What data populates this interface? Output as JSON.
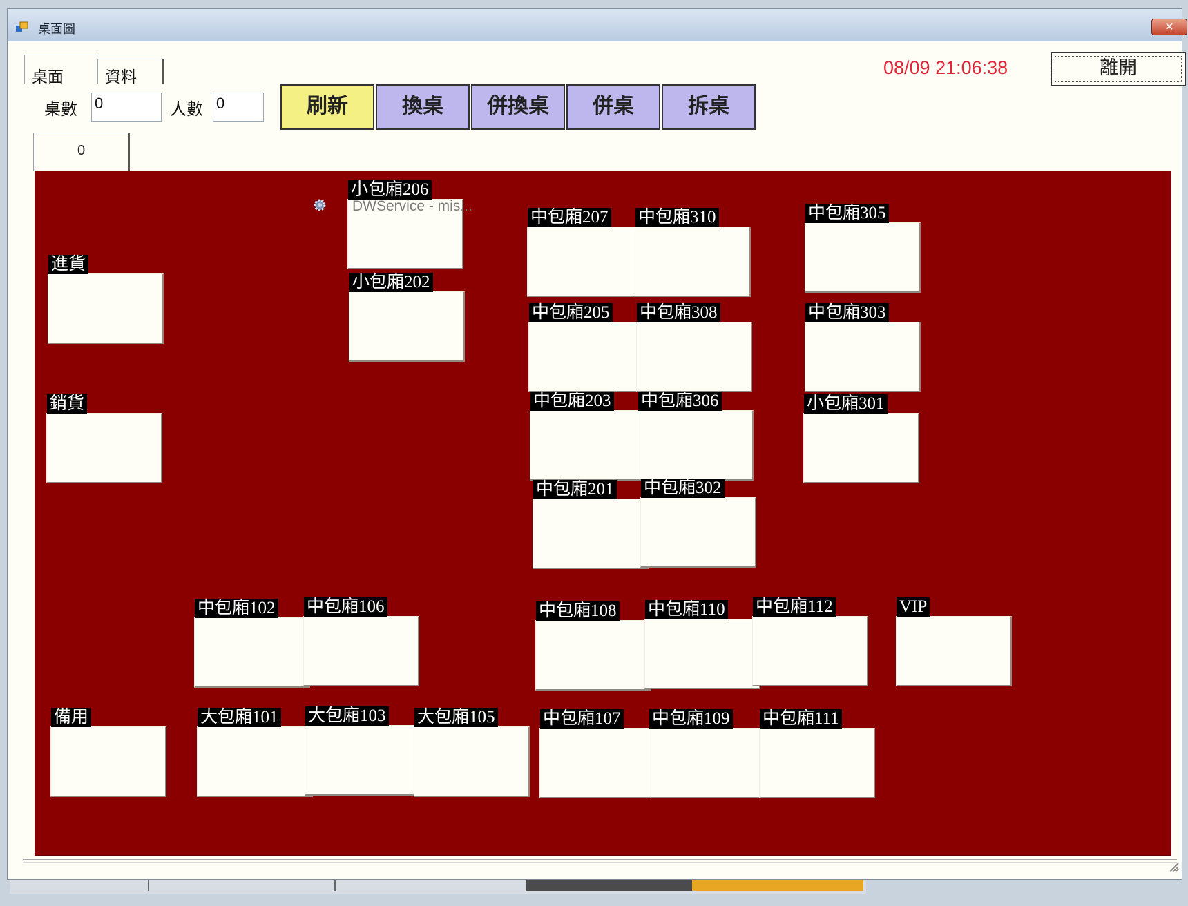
{
  "window": {
    "title": "桌面圖",
    "close_symbol": "✕"
  },
  "tabs": [
    "桌面",
    "資料"
  ],
  "clock": "08/09 21:06:38",
  "exit_button": "離開",
  "toolbar": {
    "table_count_label": "桌數",
    "table_count_value": "0",
    "people_count_label": "人數",
    "people_count_value": "0",
    "buttons": [
      "刷新",
      "換桌",
      "併換桌",
      "併桌",
      "拆桌"
    ]
  },
  "zone_tab": "0",
  "colors": {
    "floor": "#8a0000",
    "refresh": "#f4f083",
    "action": "#bdb7ee",
    "clock": "#e0283a"
  },
  "tables": [
    {
      "name": "小包廂206",
      "note": "DWService - mis..."
    },
    {
      "name": "中包廂207"
    },
    {
      "name": "中包廂310"
    },
    {
      "name": "中包廂305"
    },
    {
      "name": "進貨"
    },
    {
      "name": "小包廂202"
    },
    {
      "name": "中包廂205"
    },
    {
      "name": "中包廂308"
    },
    {
      "name": "中包廂303"
    },
    {
      "name": "銷貨"
    },
    {
      "name": "中包廂203"
    },
    {
      "name": "中包廂306"
    },
    {
      "name": "小包廂301"
    },
    {
      "name": "中包廂201"
    },
    {
      "name": "中包廂302"
    },
    {
      "name": "中包廂102"
    },
    {
      "name": "中包廂106"
    },
    {
      "name": "中包廂108"
    },
    {
      "name": "中包廂110"
    },
    {
      "name": "中包廂112"
    },
    {
      "name": "VIP"
    },
    {
      "name": "備用"
    },
    {
      "name": "大包廂101"
    },
    {
      "name": "大包廂103"
    },
    {
      "name": "大包廂105"
    },
    {
      "name": "中包廂107"
    },
    {
      "name": "中包廂109"
    },
    {
      "name": "中包廂111"
    }
  ]
}
